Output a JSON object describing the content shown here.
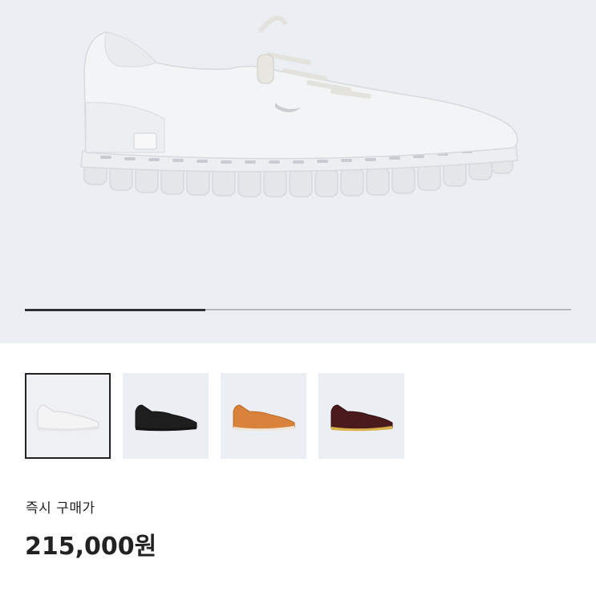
{
  "gallery": {
    "progress": 0.33,
    "thumbnails": [
      {
        "name": "white",
        "body_color": "#f1f1f1",
        "sole_color": "#e6e6e6",
        "selected": true
      },
      {
        "name": "black",
        "body_color": "#1e1e1e",
        "sole_color": "#151515",
        "selected": false
      },
      {
        "name": "orange",
        "body_color": "#d9823c",
        "sole_color": "#f0e6d8",
        "selected": false
      },
      {
        "name": "burgundy",
        "body_color": "#4a1a1c",
        "sole_color": "#d9b04a",
        "selected": false
      }
    ]
  },
  "price": {
    "label": "즉시 구매가",
    "value": "215,000원"
  }
}
